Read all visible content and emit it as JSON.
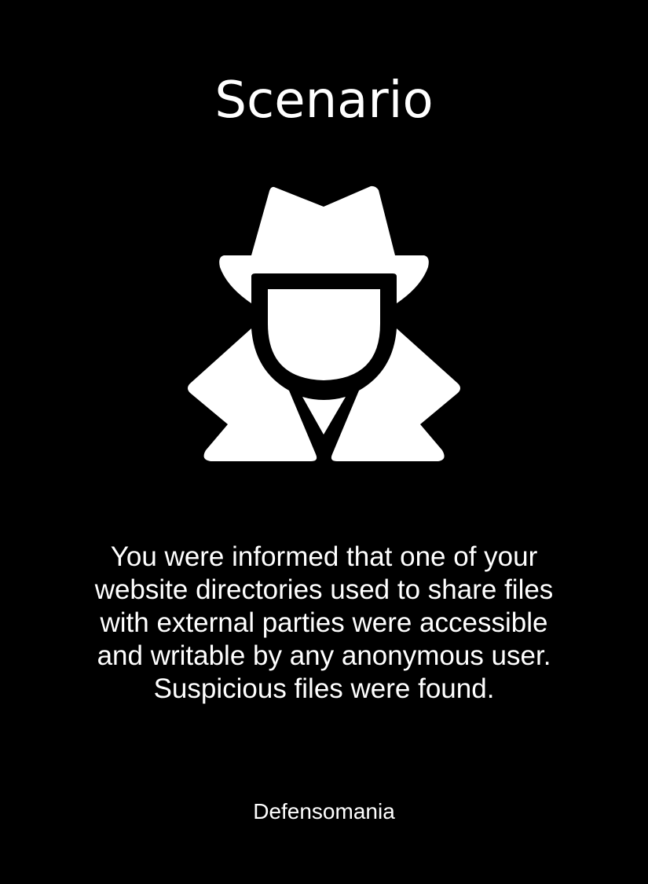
{
  "card": {
    "title": "Scenario",
    "icon": "spy-agent-icon",
    "description": "You were informed that one of your website directories used to share files with external parties were accessible and writable by any anonymous user. Suspicious files were found.",
    "brand": "Defensomania"
  },
  "colors": {
    "background": "#000000",
    "foreground": "#ffffff"
  }
}
